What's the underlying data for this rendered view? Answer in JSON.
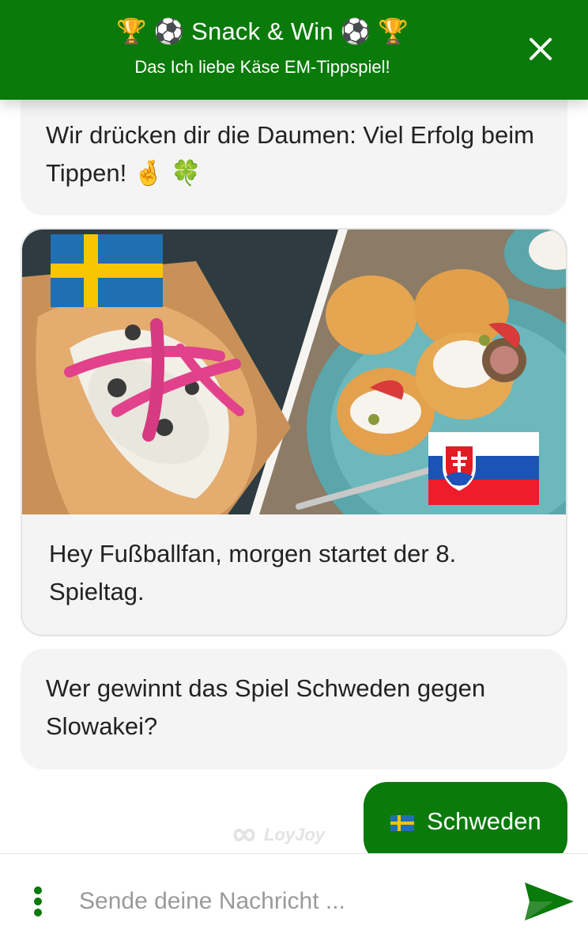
{
  "header": {
    "title": "🏆 ⚽ Snack & Win ⚽ 🏆",
    "subtitle": "Das Ich liebe Käse EM-Tippspiel!",
    "close_icon": "close-icon",
    "background_color": "#0a7a0a"
  },
  "messages": {
    "bot_1": "Wir drücken dir die Daumen: Viel Erfolg beim Tippen! 🤞 🍀",
    "card": {
      "image": "food-image-sweden-vs-slovakia",
      "text": "Hey Fußballfan, morgen startet der 8. Spieltag."
    },
    "bot_2": "Wer gewinnt das Spiel Schweden gegen Slowakei?",
    "user_reply": {
      "flag": "sweden-flag-icon",
      "label": "Schweden"
    }
  },
  "watermark": "LoyJoy",
  "input": {
    "placeholder": "Sende deine Nachricht ...",
    "value": "",
    "menu_icon": "more-vertical-icon",
    "send_icon": "send-icon"
  },
  "colors": {
    "accent": "#0a7a0a",
    "bubble": "#f4f4f4"
  }
}
